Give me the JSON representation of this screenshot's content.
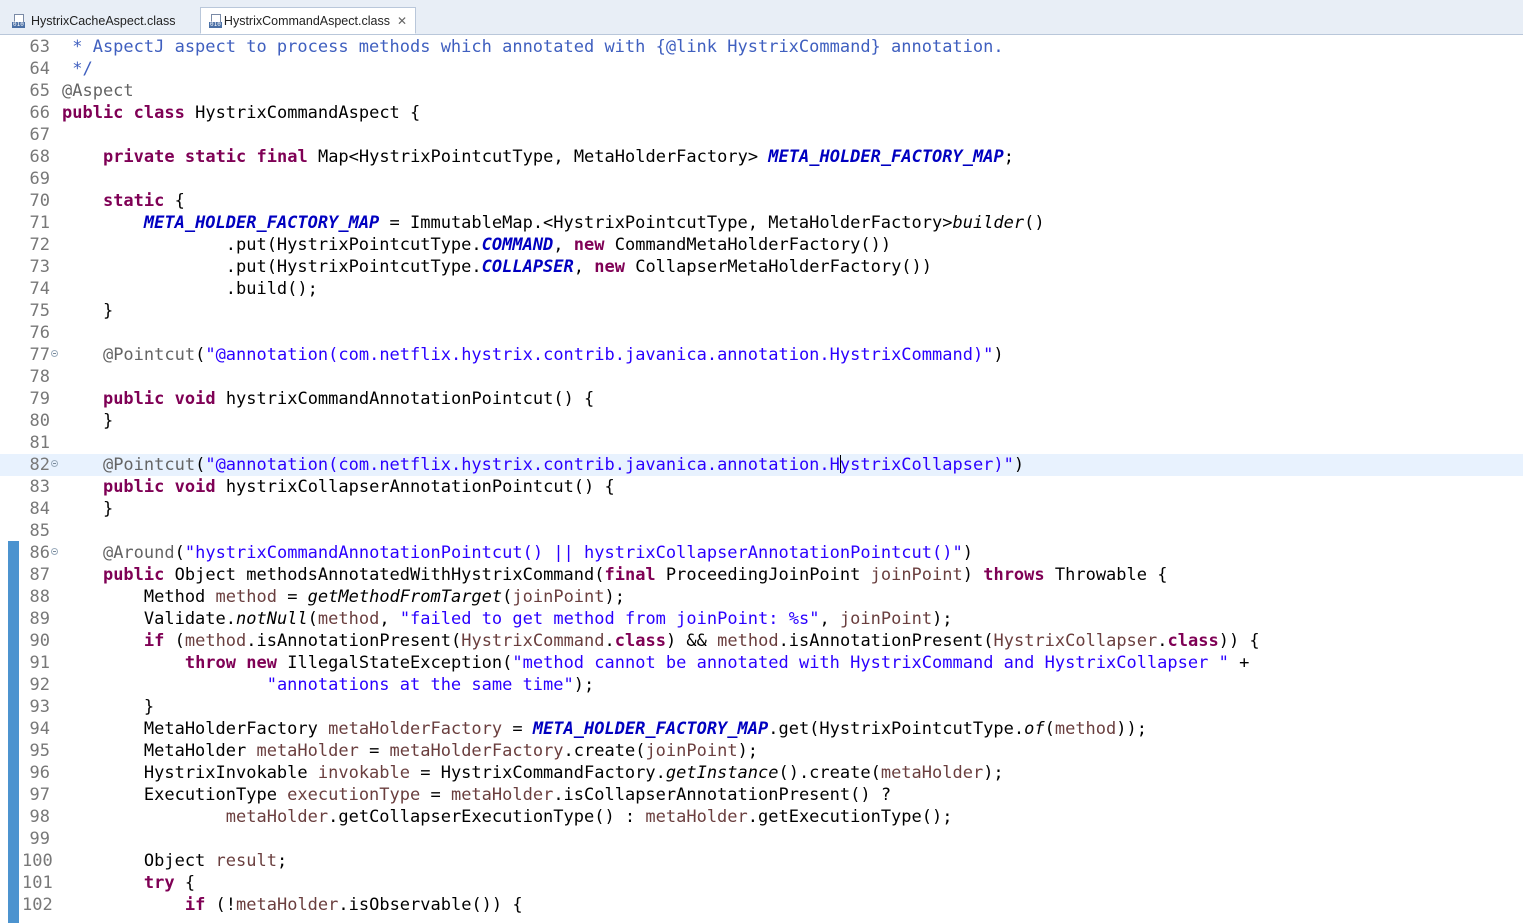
{
  "tabs": [
    {
      "label": "HystrixCacheAspect.class",
      "active": false
    },
    {
      "label": "HystrixCommandAspect.class",
      "active": true,
      "close_icon": "close-icon"
    }
  ],
  "editor": {
    "language": "java",
    "highlighted_line": 82,
    "lines": [
      {
        "n": "63",
        "tokens": [
          [
            "cm",
            " * AspectJ aspect to process methods which annotated with {@link HystrixCommand} annotation."
          ]
        ]
      },
      {
        "n": "64",
        "tokens": [
          [
            "cm",
            " */"
          ]
        ]
      },
      {
        "n": "65",
        "tokens": [
          [
            "ann",
            "@Aspect"
          ]
        ]
      },
      {
        "n": "66",
        "tokens": [
          [
            "kw",
            "public"
          ],
          [
            "",
            " "
          ],
          [
            "kw",
            "class"
          ],
          [
            "",
            " HystrixCommandAspect {"
          ]
        ]
      },
      {
        "n": "67",
        "tokens": []
      },
      {
        "n": "68",
        "tokens": [
          [
            "",
            "    "
          ],
          [
            "kw",
            "private"
          ],
          [
            "",
            " "
          ],
          [
            "kw",
            "static"
          ],
          [
            "",
            " "
          ],
          [
            "kw",
            "final"
          ],
          [
            "",
            " Map<HystrixPointcutType, MetaHolderFactory> "
          ],
          [
            "fld",
            "META_HOLDER_FACTORY_MAP"
          ],
          [
            "",
            ";"
          ]
        ]
      },
      {
        "n": "69",
        "tokens": []
      },
      {
        "n": "70",
        "tokens": [
          [
            "",
            "    "
          ],
          [
            "kw",
            "static"
          ],
          [
            "",
            " {"
          ]
        ]
      },
      {
        "n": "71",
        "tokens": [
          [
            "",
            "        "
          ],
          [
            "fld",
            "META_HOLDER_FACTORY_MAP"
          ],
          [
            "",
            " = ImmutableMap.<HystrixPointcutType, MetaHolderFactory>"
          ],
          [
            "smeth",
            "builder"
          ],
          [
            "",
            "()"
          ]
        ]
      },
      {
        "n": "72",
        "tokens": [
          [
            "",
            "                .put(HystrixPointcutType."
          ],
          [
            "fld",
            "COMMAND"
          ],
          [
            "",
            ", "
          ],
          [
            "kw",
            "new"
          ],
          [
            "",
            " CommandMetaHolderFactory())"
          ]
        ]
      },
      {
        "n": "73",
        "tokens": [
          [
            "",
            "                .put(HystrixPointcutType."
          ],
          [
            "fld",
            "COLLAPSER"
          ],
          [
            "",
            ", "
          ],
          [
            "kw",
            "new"
          ],
          [
            "",
            " CollapserMetaHolderFactory())"
          ]
        ]
      },
      {
        "n": "74",
        "tokens": [
          [
            "",
            "                .build();"
          ]
        ]
      },
      {
        "n": "75",
        "tokens": [
          [
            "",
            "    }"
          ]
        ]
      },
      {
        "n": "76",
        "tokens": []
      },
      {
        "n": "77",
        "fold": true,
        "tokens": [
          [
            "",
            "    "
          ],
          [
            "ann",
            "@Pointcut"
          ],
          [
            "",
            "("
          ],
          [
            "str",
            "\"@annotation(com.netflix.hystrix.contrib.javanica.annotation.HystrixCommand)\""
          ],
          [
            "",
            ")"
          ]
        ]
      },
      {
        "n": "78",
        "tokens": []
      },
      {
        "n": "79",
        "tokens": [
          [
            "",
            "    "
          ],
          [
            "kw",
            "public"
          ],
          [
            "",
            " "
          ],
          [
            "kw",
            "void"
          ],
          [
            "",
            " hystrixCommandAnnotationPointcut() {"
          ]
        ]
      },
      {
        "n": "80",
        "tokens": [
          [
            "",
            "    }"
          ]
        ]
      },
      {
        "n": "81",
        "tokens": []
      },
      {
        "n": "82",
        "fold": true,
        "tokens": [
          [
            "",
            "    "
          ],
          [
            "ann",
            "@Pointcut"
          ],
          [
            "",
            "("
          ],
          [
            "str",
            "\"@annotation(com.netflix.hystrix.contrib.javanica.annotation.H"
          ],
          [
            "caret",
            ""
          ],
          [
            "str",
            "ystrixCollapser)\""
          ],
          [
            "",
            ")"
          ]
        ]
      },
      {
        "n": "83",
        "tokens": [
          [
            "",
            "    "
          ],
          [
            "kw",
            "public"
          ],
          [
            "",
            " "
          ],
          [
            "kw",
            "void"
          ],
          [
            "",
            " hystrixCollapserAnnotationPointcut() {"
          ]
        ]
      },
      {
        "n": "84",
        "tokens": [
          [
            "",
            "    }"
          ]
        ]
      },
      {
        "n": "85",
        "tokens": []
      },
      {
        "n": "86",
        "fold": true,
        "tokens": [
          [
            "",
            "    "
          ],
          [
            "ann",
            "@Around"
          ],
          [
            "",
            "("
          ],
          [
            "str",
            "\"hystrixCommandAnnotationPointcut() || hystrixCollapserAnnotationPointcut()\""
          ],
          [
            "",
            ")"
          ]
        ]
      },
      {
        "n": "87",
        "tokens": [
          [
            "",
            "    "
          ],
          [
            "kw",
            "public"
          ],
          [
            "",
            " Object methodsAnnotatedWithHystrixCommand("
          ],
          [
            "kw",
            "final"
          ],
          [
            "",
            " ProceedingJoinPoint "
          ],
          [
            "lv",
            "joinPoint"
          ],
          [
            "",
            ") "
          ],
          [
            "kw",
            "throws"
          ],
          [
            "",
            " Throwable {"
          ]
        ]
      },
      {
        "n": "88",
        "tokens": [
          [
            "",
            "        Method "
          ],
          [
            "lv",
            "method"
          ],
          [
            "",
            " = "
          ],
          [
            "smeth",
            "getMethodFromTarget"
          ],
          [
            "",
            "("
          ],
          [
            "lv",
            "joinPoint"
          ],
          [
            "",
            ");"
          ]
        ]
      },
      {
        "n": "89",
        "tokens": [
          [
            "",
            "        Validate."
          ],
          [
            "smeth",
            "notNull"
          ],
          [
            "",
            "("
          ],
          [
            "lv",
            "method"
          ],
          [
            "",
            ", "
          ],
          [
            "str",
            "\"failed to get method from joinPoint: %s\""
          ],
          [
            "",
            ", "
          ],
          [
            "lv",
            "joinPoint"
          ],
          [
            "",
            ");"
          ]
        ]
      },
      {
        "n": "90",
        "tokens": [
          [
            "",
            "        "
          ],
          [
            "kw",
            "if"
          ],
          [
            "",
            " ("
          ],
          [
            "lv",
            "method"
          ],
          [
            "",
            ".isAnnotationPresent("
          ],
          [
            "lv",
            "HystrixCommand"
          ],
          [
            "",
            "."
          ],
          [
            "kw",
            "class"
          ],
          [
            "",
            ") && "
          ],
          [
            "lv",
            "method"
          ],
          [
            "",
            ".isAnnotationPresent("
          ],
          [
            "lv",
            "HystrixCollapser"
          ],
          [
            "",
            "."
          ],
          [
            "kw",
            "class"
          ],
          [
            "",
            ")) {"
          ]
        ]
      },
      {
        "n": "91",
        "tokens": [
          [
            "",
            "            "
          ],
          [
            "kw",
            "throw"
          ],
          [
            "",
            " "
          ],
          [
            "kw",
            "new"
          ],
          [
            "",
            " IllegalStateException("
          ],
          [
            "str",
            "\"method cannot be annotated with HystrixCommand and HystrixCollapser \""
          ],
          [
            "",
            " +"
          ]
        ]
      },
      {
        "n": "92",
        "tokens": [
          [
            "",
            "                    "
          ],
          [
            "str",
            "\"annotations at the same time\""
          ],
          [
            "",
            ");"
          ]
        ]
      },
      {
        "n": "93",
        "tokens": [
          [
            "",
            "        }"
          ]
        ]
      },
      {
        "n": "94",
        "tokens": [
          [
            "",
            "        MetaHolderFactory "
          ],
          [
            "lv",
            "metaHolderFactory"
          ],
          [
            "",
            " = "
          ],
          [
            "fld",
            "META_HOLDER_FACTORY_MAP"
          ],
          [
            "",
            ".get(HystrixPointcutType."
          ],
          [
            "smeth",
            "of"
          ],
          [
            "",
            "("
          ],
          [
            "lv",
            "method"
          ],
          [
            "",
            "));"
          ]
        ]
      },
      {
        "n": "95",
        "tokens": [
          [
            "",
            "        MetaHolder "
          ],
          [
            "lv",
            "metaHolder"
          ],
          [
            "",
            " = "
          ],
          [
            "lv",
            "metaHolderFactory"
          ],
          [
            "",
            ".create("
          ],
          [
            "lv",
            "joinPoint"
          ],
          [
            "",
            ");"
          ]
        ]
      },
      {
        "n": "96",
        "tokens": [
          [
            "",
            "        HystrixInvokable "
          ],
          [
            "lv",
            "invokable"
          ],
          [
            "",
            " = HystrixCommandFactory."
          ],
          [
            "smeth",
            "getInstance"
          ],
          [
            "",
            "().create("
          ],
          [
            "lv",
            "metaHolder"
          ],
          [
            "",
            ");"
          ]
        ]
      },
      {
        "n": "97",
        "tokens": [
          [
            "",
            "        ExecutionType "
          ],
          [
            "lv",
            "executionType"
          ],
          [
            "",
            " = "
          ],
          [
            "lv",
            "metaHolder"
          ],
          [
            "",
            ".isCollapserAnnotationPresent() ?"
          ]
        ]
      },
      {
        "n": "98",
        "tokens": [
          [
            "",
            "                "
          ],
          [
            "lv",
            "metaHolder"
          ],
          [
            "",
            ".getCollapserExecutionType() : "
          ],
          [
            "lv",
            "metaHolder"
          ],
          [
            "",
            ".getExecutionType();"
          ]
        ]
      },
      {
        "n": "99",
        "tokens": []
      },
      {
        "n": "100",
        "tokens": [
          [
            "",
            "        Object "
          ],
          [
            "lv",
            "result"
          ],
          [
            "",
            ";"
          ]
        ]
      },
      {
        "n": "101",
        "tokens": [
          [
            "",
            "        "
          ],
          [
            "kw",
            "try"
          ],
          [
            "",
            " {"
          ]
        ]
      },
      {
        "n": "102",
        "tokens": [
          [
            "",
            "            "
          ],
          [
            "kw",
            "if"
          ],
          [
            "",
            " (!"
          ],
          [
            "lv",
            "metaHolder"
          ],
          [
            "",
            ".isObservable()) {"
          ]
        ]
      }
    ]
  }
}
